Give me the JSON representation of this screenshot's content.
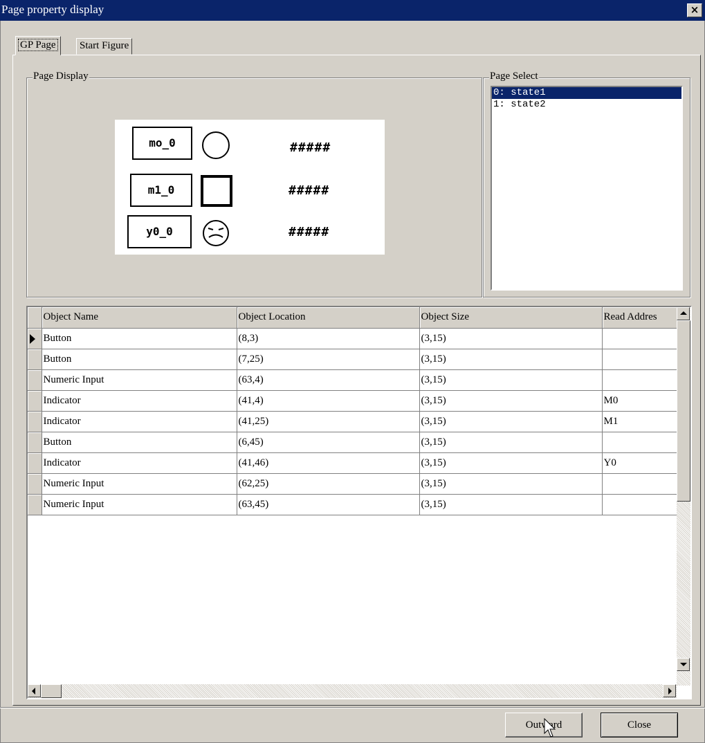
{
  "window": {
    "title": "Page property display",
    "close_glyph": "×"
  },
  "tabs": [
    {
      "label": "GP Page"
    },
    {
      "label": "Start Figure"
    }
  ],
  "page_display": {
    "label": "Page Display",
    "items": [
      {
        "button": "mo_0",
        "shape": "circle-outline-icon",
        "value": "#####"
      },
      {
        "button": "m1_0",
        "shape": "square-outline-icon",
        "value": "#####"
      },
      {
        "button": "y0_0",
        "shape": "sad-face-icon",
        "value": "#####"
      }
    ]
  },
  "page_select": {
    "label": "Page Select",
    "items": [
      {
        "label": "0: state1",
        "selected": true
      },
      {
        "label": "1: state2",
        "selected": false
      }
    ]
  },
  "grid": {
    "columns": [
      "Object Name",
      "Object Location",
      "Object Size",
      "Read Addres"
    ],
    "rows": [
      {
        "name": "Button",
        "location": "(8,3)",
        "size": "(3,15)",
        "read_address": "",
        "current": true
      },
      {
        "name": "Button",
        "location": "(7,25)",
        "size": "(3,15)",
        "read_address": ""
      },
      {
        "name": "Numeric Input",
        "location": "(63,4)",
        "size": "(3,15)",
        "read_address": ""
      },
      {
        "name": "Indicator",
        "location": "(41,4)",
        "size": "(3,15)",
        "read_address": "M0"
      },
      {
        "name": "Indicator",
        "location": "(41,25)",
        "size": "(3,15)",
        "read_address": "M1"
      },
      {
        "name": "Button",
        "location": "(6,45)",
        "size": "(3,15)",
        "read_address": ""
      },
      {
        "name": "Indicator",
        "location": "(41,46)",
        "size": "(3,15)",
        "read_address": "Y0"
      },
      {
        "name": "Numeric Input",
        "location": "(62,25)",
        "size": "(3,15)",
        "read_address": ""
      },
      {
        "name": "Numeric Input",
        "location": "(63,45)",
        "size": "(3,15)",
        "read_address": ""
      }
    ]
  },
  "buttons": {
    "outward": "Outward",
    "close": "Close"
  },
  "colors": {
    "face": "#d4d0c8",
    "title_bar": "#0a246a",
    "selection": "#0a246a"
  }
}
